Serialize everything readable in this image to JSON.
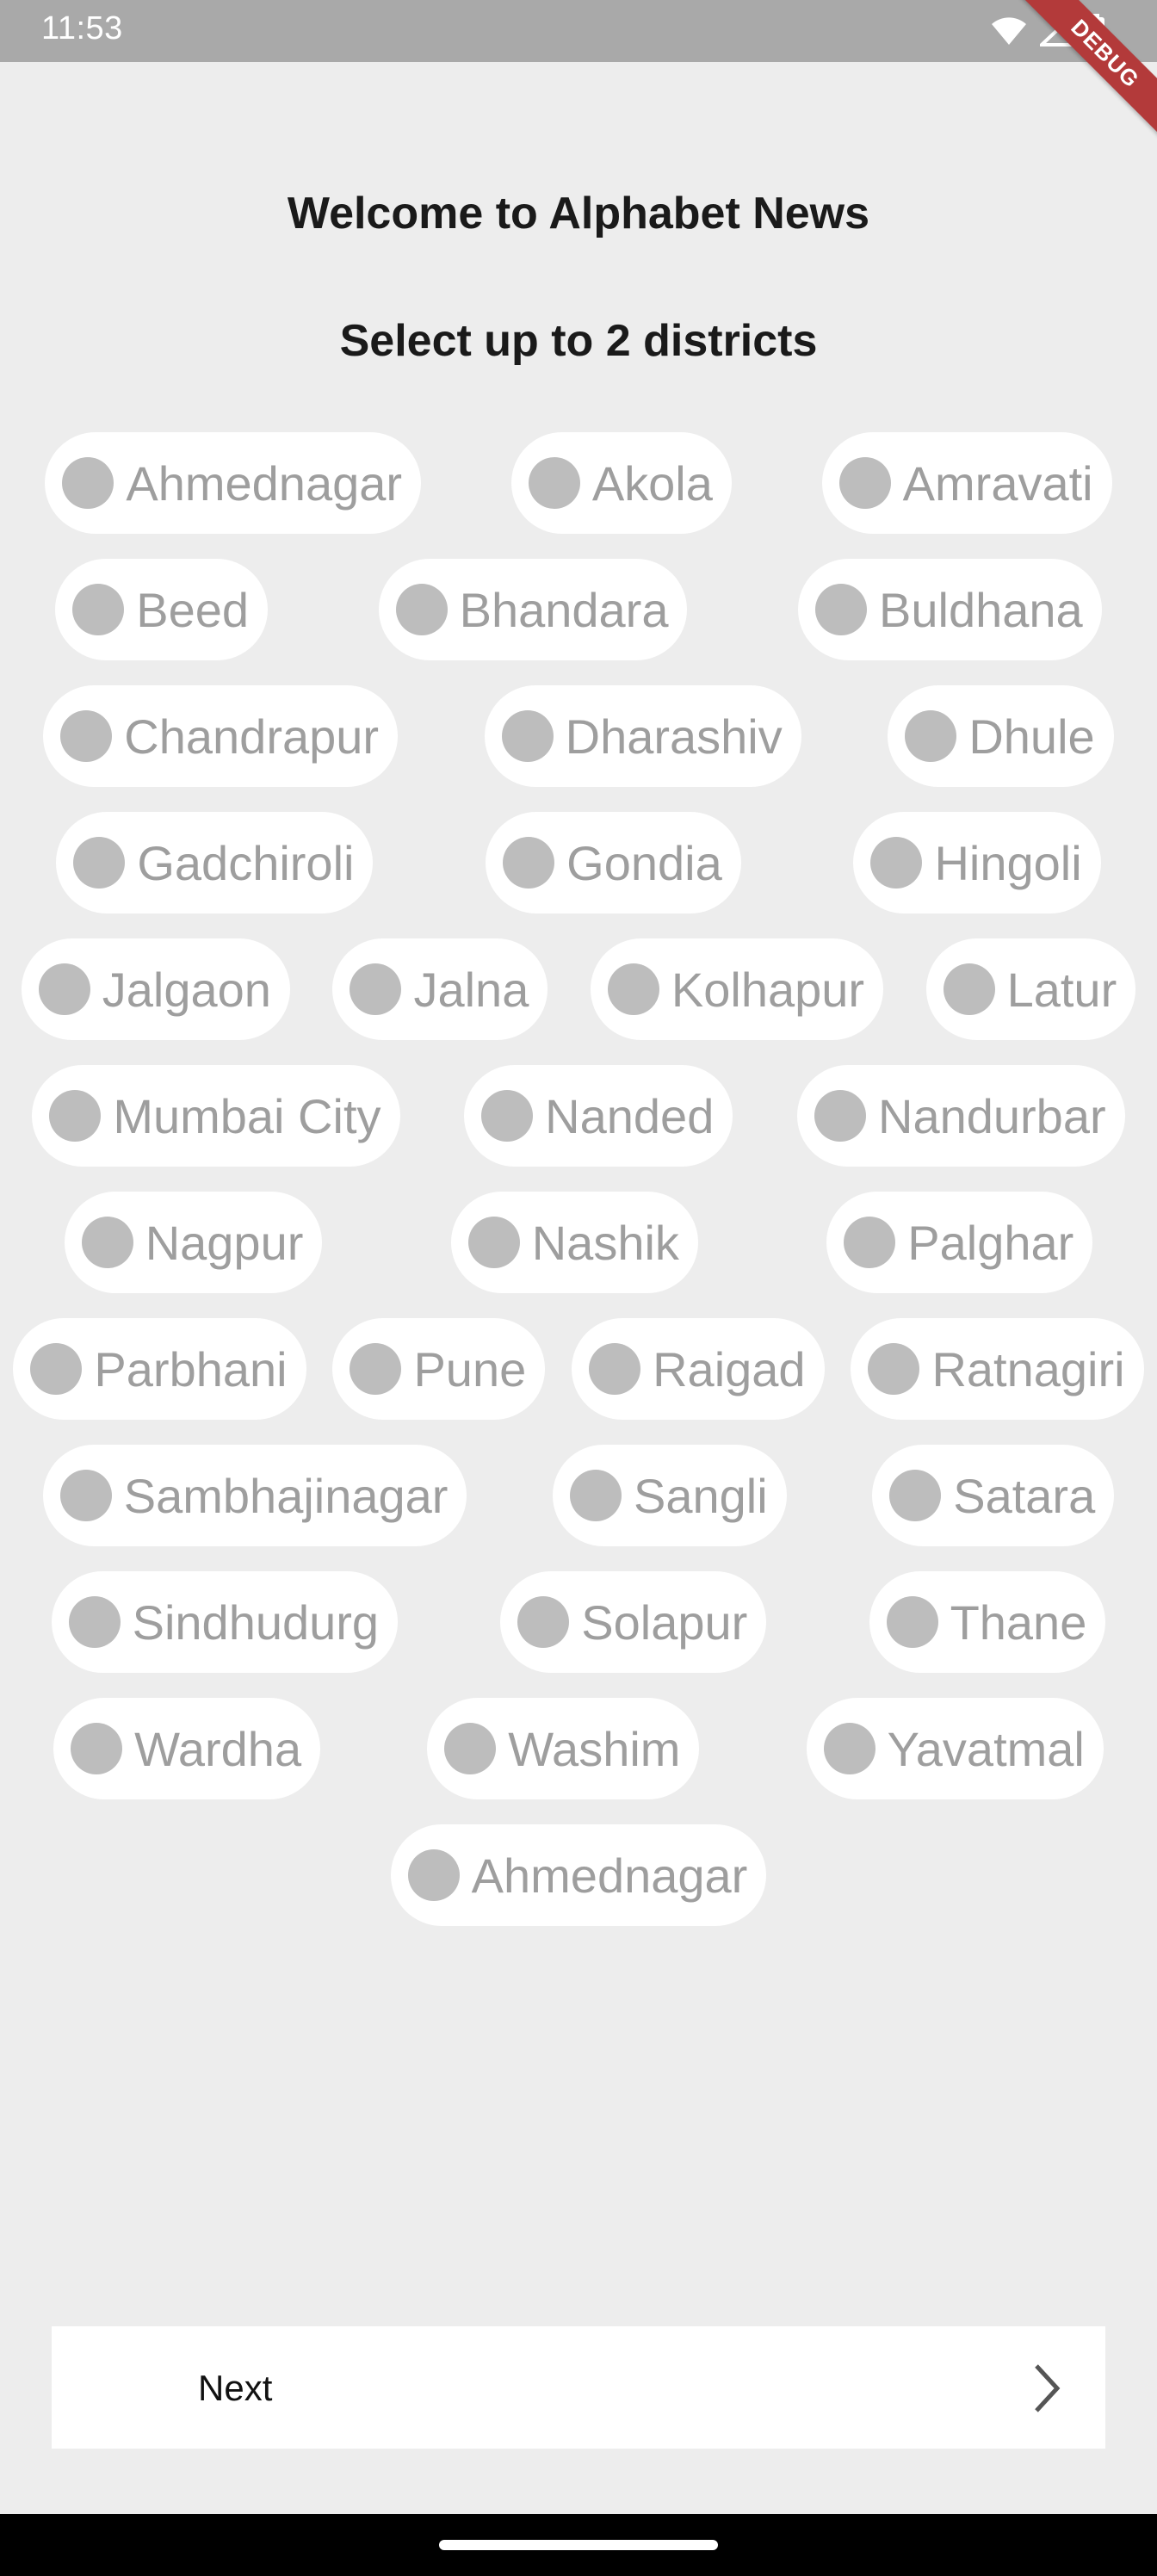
{
  "status_bar": {
    "time": "11:53"
  },
  "debug_banner": "DEBUG",
  "header": {
    "title": "Welcome to Alphabet News",
    "subtitle": "Select up to 2 districts"
  },
  "chips": {
    "items": [
      "Ahmednagar",
      "Akola",
      "Amravati",
      "Beed",
      "Bhandara",
      "Buldhana",
      "Chandrapur",
      "Dharashiv",
      "Dhule",
      "Gadchiroli",
      "Gondia",
      "Hingoli",
      "Jalgaon",
      "Jalna",
      "Kolhapur",
      "Latur",
      "Mumbai City",
      "Nanded",
      "Nandurbar",
      "Nagpur",
      "Nashik",
      "Palghar",
      "Parbhani",
      "Pune",
      "Raigad",
      "Ratnagiri",
      "Sambhajinagar",
      "Sangli",
      "Satara",
      "Sindhudurg",
      "Solapur",
      "Thane",
      "Wardha",
      "Washim",
      "Yavatmal",
      "Ahmednagar"
    ],
    "selected": []
  },
  "footer": {
    "next_label": "Next"
  },
  "icons": {
    "status": [
      "wifi-icon",
      "signal-icon",
      "battery-icon"
    ],
    "next": "chevron-right-icon"
  },
  "colors": {
    "background": "#ededed",
    "status_bar": "#a9a9a9",
    "chip_background": "#ffffff",
    "chip_radio": "#bdbdbd",
    "chip_text": "#9e9e9e",
    "debug_banner": "#b33a3a"
  }
}
